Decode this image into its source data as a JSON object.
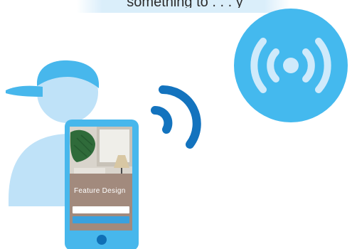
{
  "header": {
    "caption": "something to . . . y"
  },
  "phone_app": {
    "title": "Feature Design",
    "subtitle": "",
    "primary_button_label": "",
    "secondary_button_label": ""
  },
  "colors": {
    "accent_light": "#bfe2f8",
    "accent": "#43b9ef",
    "accent_dark": "#0e6fb8",
    "signal_wave": "#1373be"
  },
  "icons": {
    "beacon": "broadcast-icon",
    "signal": "wifi-waves-icon",
    "user": "person-icon",
    "phone": "smartphone-icon"
  }
}
